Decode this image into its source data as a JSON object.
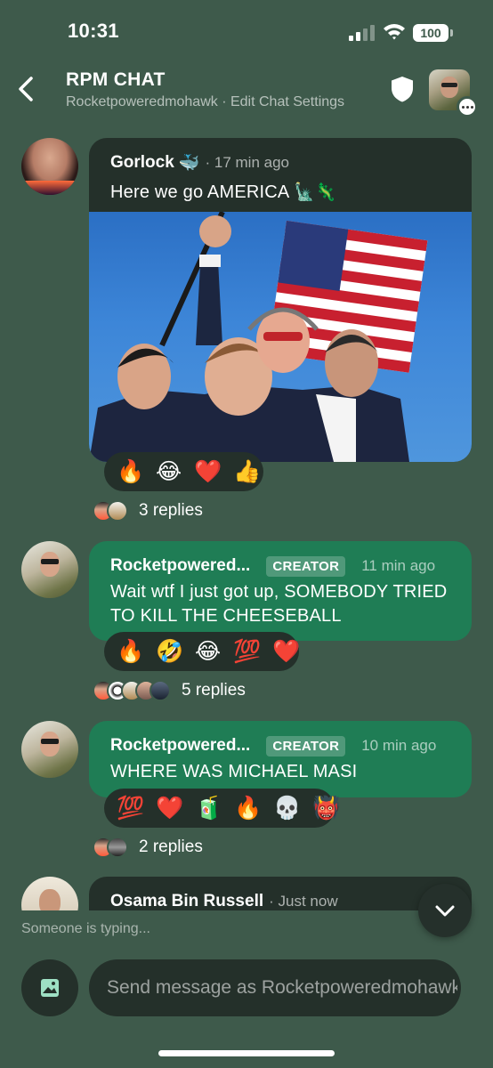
{
  "status_bar": {
    "time": "10:31",
    "battery": "100"
  },
  "header": {
    "title": "RPM CHAT",
    "subtitle": "Rocketpoweredmohawk · Edit Chat Settings",
    "back_icon": "chevron-left-icon",
    "shield_icon": "shield-icon"
  },
  "messages": [
    {
      "author": "Gorlock",
      "author_emoji": "🐳",
      "time": "· 17 min ago",
      "text": "Here we go AMERICA",
      "text_emoji": "🗽🦎",
      "has_image": true,
      "reactions": [
        "🔥",
        "😂",
        "❤️",
        "👍"
      ],
      "replies": "3 replies"
    },
    {
      "author": "Rocketpowered...",
      "badge": "CREATOR",
      "time": "11 min ago",
      "text": "Wait wtf I just got up, SOMEBODY TRIED TO KILL THE CHEESEBALL",
      "reactions": [
        "🔥",
        "🤣",
        "😂",
        "💯",
        "❤️"
      ],
      "replies": "5 replies"
    },
    {
      "author": "Rocketpowered...",
      "badge": "CREATOR",
      "time": "10 min ago",
      "text": "WHERE WAS MICHAEL MASI",
      "reactions": [
        "💯",
        "❤️",
        "🧃",
        "🔥",
        "💀",
        "👹"
      ],
      "replies": "2 replies"
    },
    {
      "author": "Osama Bin Russell",
      "time": "· Just now"
    }
  ],
  "typing_indicator": "Someone is typing...",
  "composer": {
    "placeholder": "Send message as Rocketpoweredmohawk"
  },
  "colors": {
    "background": "#3e5a4b",
    "bubble_dark": "#24302a",
    "bubble_creator": "#1f7d55"
  }
}
